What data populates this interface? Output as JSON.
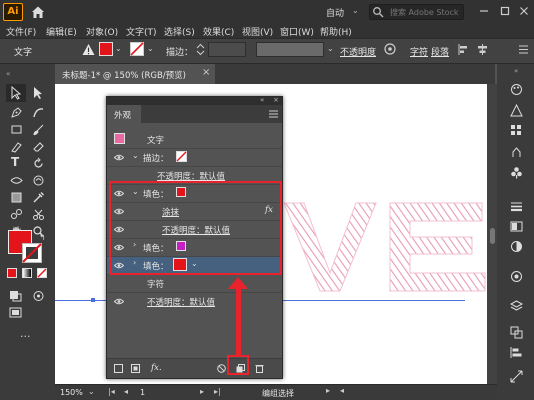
{
  "app": {
    "logo": "Ai",
    "workspace": "自动",
    "search_placeholder": "搜索 Adobe Stock"
  },
  "menu": [
    "文件(F)",
    "编辑(E)",
    "对象(O)",
    "文字(T)",
    "选择(S)",
    "效果(C)",
    "视图(V)",
    "窗口(W)",
    "帮助(H)"
  ],
  "control": {
    "object_type": "文字",
    "stroke_label": "描边：",
    "opacity_label": "不透明度",
    "char_label": "字符",
    "para_label": "段落",
    "fill_color": "#e4141b"
  },
  "document": {
    "tab_title": "未标题-1* @ 150% (RGB/预览)",
    "artwork_text": "VE",
    "artwork_color": "#f0a8c0"
  },
  "appearance": {
    "panel_title": "外观",
    "rows": [
      {
        "label": "文字"
      },
      {
        "label": "描边："
      },
      {
        "label": "不透明度：默认值"
      },
      {
        "label": "填色："
      },
      {
        "label": "涂抹"
      },
      {
        "label": "不透明度：默认值"
      },
      {
        "label": "填色："
      },
      {
        "label": "填色："
      },
      {
        "label": "字符"
      },
      {
        "label": "不透明度：默认值"
      }
    ],
    "fx_label": "fx",
    "footer_fx": "fx.",
    "colors": {
      "header_swatch": "#e86aa0",
      "fill1": "#e4141b",
      "fill2": "#c81ec8",
      "fill3": "#e4141b"
    }
  },
  "status": {
    "zoom": "150%",
    "artboard_num": "1",
    "mode": "编组选择"
  },
  "colors": {
    "annotation_red": "#e8232b",
    "selection_blue": "#46607f"
  }
}
